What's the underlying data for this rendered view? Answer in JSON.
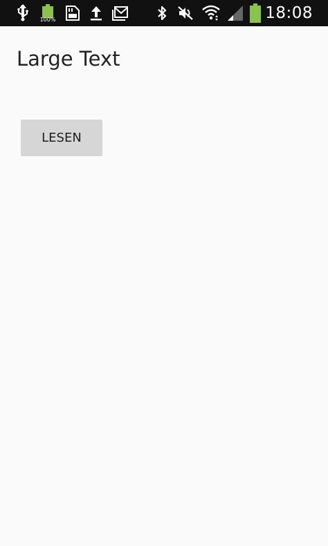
{
  "status_bar": {
    "time": "18:08",
    "battery_badge_label": "100%",
    "icons": [
      "usb-icon",
      "battery-full-badge-icon",
      "sd-card-icon",
      "upload-icon",
      "gmail-icon",
      "bluetooth-icon",
      "mute-icon",
      "wifi-icon",
      "signal-icon",
      "battery-icon"
    ],
    "colors": {
      "background": "#111111",
      "icon": "#ffffff",
      "battery_green": "#8bc34a",
      "signal_dim": "#666666"
    }
  },
  "main": {
    "large_text": "Large Text",
    "read_button_label": "LESEN"
  },
  "colors": {
    "page_background": "#fafafa",
    "button_background": "#d6d6d6",
    "text": "#222222"
  }
}
